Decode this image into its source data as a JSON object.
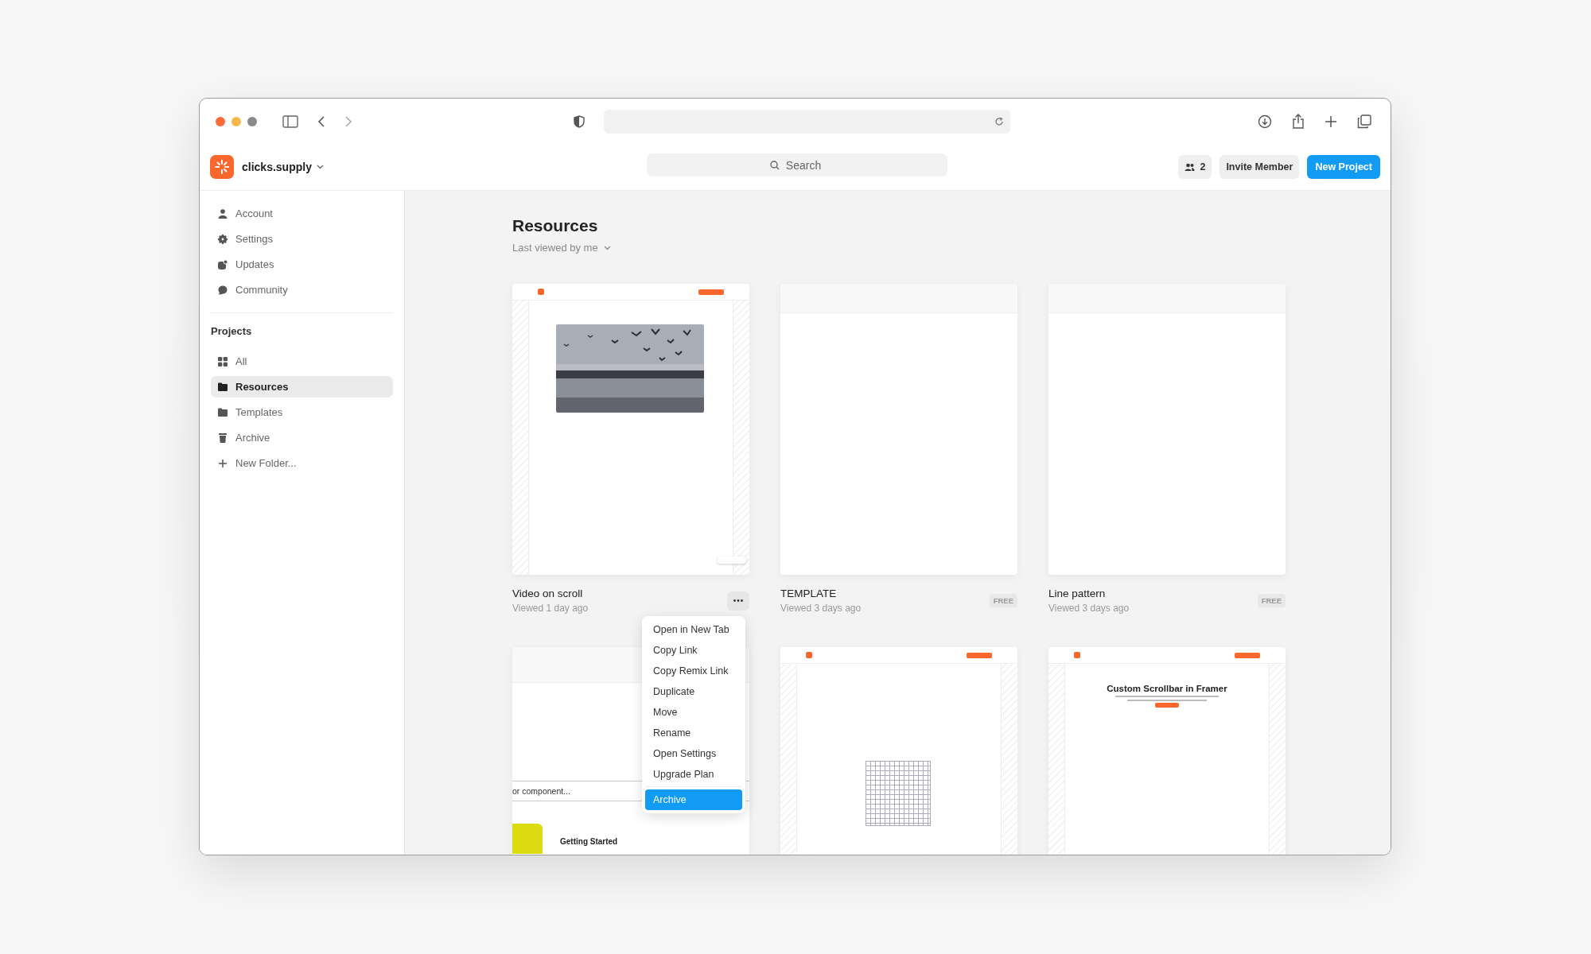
{
  "app_header": {
    "brand": "clicks.supply",
    "search": {
      "placeholder": "Search"
    },
    "members": "2",
    "buttons": [
      "Invite Member",
      "New Project"
    ]
  },
  "sidebar": {
    "items": [
      {
        "label": "Account",
        "selected": false
      },
      {
        "label": "Settings",
        "selected": false
      },
      {
        "label": "Updates",
        "selected": false
      },
      {
        "label": "Community",
        "selected": false
      }
    ],
    "projects_heading": "Projects",
    "projects": [
      {
        "label": "All",
        "selected": false
      },
      {
        "label": "Resources",
        "selected": true
      },
      {
        "label": "Templates",
        "selected": false
      },
      {
        "label": "Archive",
        "selected": false
      },
      {
        "label": "New Folder...",
        "selected": false
      }
    ]
  },
  "content": {
    "title": "Resources",
    "filter": "Last viewed by me",
    "cards": [
      {
        "kind": "video",
        "title": "Video on scroll",
        "subtitle": "Viewed 1 day ago",
        "hovered": true
      },
      {
        "kind": "blank",
        "title": "TEMPLATE",
        "subtitle": "Viewed 3 days ago",
        "badge": "FREE",
        "hovered": false
      },
      {
        "kind": "blank",
        "title": "Line pattern",
        "subtitle": "Viewed 3 days ago",
        "badge": "FREE",
        "hovered": false
      },
      {
        "kind": "component",
        "field_text": "or component...",
        "label": "Getting Started"
      },
      {
        "kind": "grid"
      },
      {
        "kind": "scrollbar",
        "heading": "Custom Scrollbar in Framer"
      }
    ]
  },
  "context_menu": {
    "items": [
      {
        "label": "Open in New Tab",
        "selected": false
      },
      {
        "label": "Copy Link",
        "selected": false
      },
      {
        "label": "Copy Remix Link",
        "selected": false
      },
      {
        "label": "Duplicate",
        "selected": false
      },
      {
        "label": "Move",
        "selected": false
      },
      {
        "label": "Rename",
        "selected": false
      },
      {
        "label": "Open Settings",
        "selected": false
      },
      {
        "label": "Upgrade Plan",
        "selected": false
      },
      {
        "label": "Archive",
        "selected": true
      }
    ]
  }
}
